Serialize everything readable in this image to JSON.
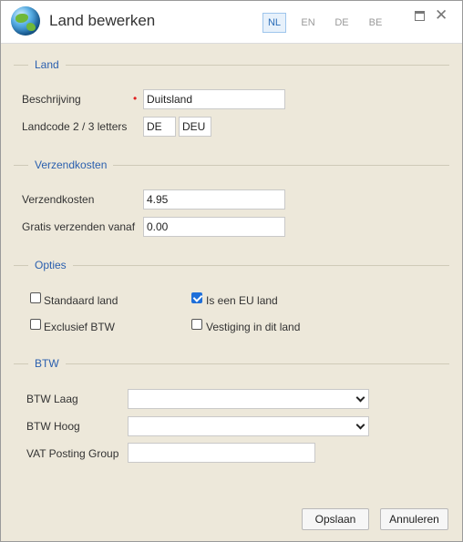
{
  "window": {
    "title": "Land bewerken"
  },
  "languages": [
    {
      "code": "NL",
      "active": true
    },
    {
      "code": "EN",
      "active": false
    },
    {
      "code": "DE",
      "active": false
    },
    {
      "code": "BE",
      "active": false
    }
  ],
  "sections": {
    "land": "Land",
    "verzendkosten": "Verzendkosten",
    "opties": "Opties",
    "btw": "BTW"
  },
  "land": {
    "beschrijving_label": "Beschrijving",
    "beschrijving_value": "Duitsland",
    "landcode_label": "Landcode 2 / 3 letters",
    "code2_value": "DE",
    "code3_value": "DEU"
  },
  "verzendkosten": {
    "kosten_label": "Verzendkosten",
    "kosten_value": "4.95",
    "gratis_label": "Gratis verzenden vanaf",
    "gratis_value": "0.00"
  },
  "opties": {
    "standaard_label": "Standaard land",
    "standaard_checked": false,
    "eu_label": "Is een EU land",
    "eu_checked": true,
    "exclusief_label": "Exclusief BTW",
    "exclusief_checked": false,
    "vestiging_label": "Vestiging in dit land",
    "vestiging_checked": false
  },
  "btw": {
    "laag_label": "BTW Laag",
    "laag_value": "",
    "hoog_label": "BTW Hoog",
    "hoog_value": "",
    "vat_label": "VAT Posting Group",
    "vat_value": ""
  },
  "buttons": {
    "save": "Opslaan",
    "cancel": "Annuleren"
  },
  "colors": {
    "accent": "#2a5fae",
    "background": "#ede8da",
    "required": "#e02020",
    "checkbox": "#1e6fd9"
  }
}
